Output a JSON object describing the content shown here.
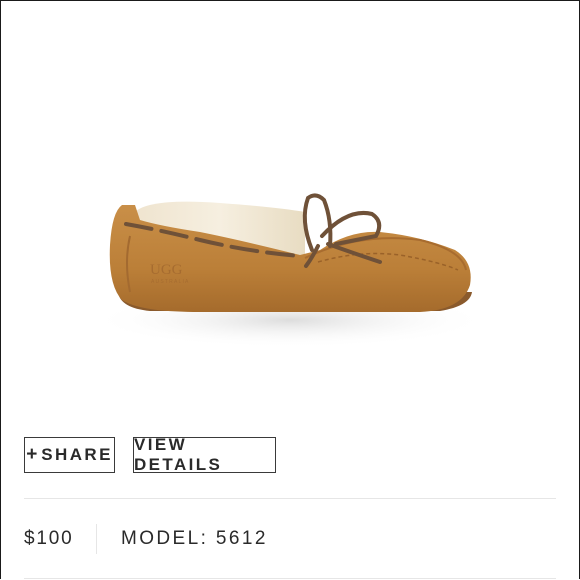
{
  "product": {
    "image_alt": "UGG moccasin slipper",
    "logo_text": "UGG",
    "logo_subtext": "AUSTRALIA"
  },
  "actions": {
    "share_plus": "+",
    "share_label": "SHARE",
    "details_label": "VIEW DETAILS"
  },
  "info": {
    "price": "$100",
    "model": "MODEL: 5612"
  },
  "colors": {
    "suede": "#c0843d",
    "suede_dark": "#9c6427",
    "fur": "#f3ead9",
    "lace": "#6f5138",
    "border": "#3a3a3a"
  }
}
